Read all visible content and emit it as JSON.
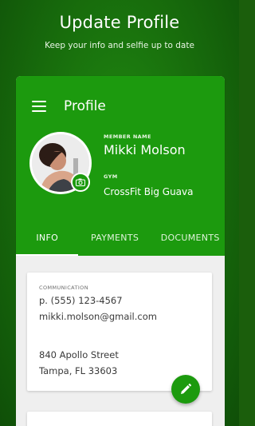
{
  "hero": {
    "title": "Update Profile",
    "subtitle": "Keep your info and selfie up to date"
  },
  "appbar": {
    "menu_icon": "hamburger-menu-icon",
    "title": "Profile"
  },
  "profile": {
    "avatar_icon": "user-photo",
    "camera_icon": "camera-icon",
    "member_label": "MEMBER NAME",
    "member_name": "Mikki Molson",
    "gym_label": "GYM",
    "gym_name": "CrossFit Big Guava"
  },
  "tabs": [
    {
      "label": "INFO",
      "active": true
    },
    {
      "label": "PAYMENTS",
      "active": false
    },
    {
      "label": "DOCUMENTS",
      "active": false
    }
  ],
  "communication": {
    "label": "COMMUNICATION",
    "phone": "p. (555) 123-4567",
    "email": "mikki.molson@gmail.com",
    "street": "840 Apollo Street",
    "city": "Tampa, FL 33603"
  },
  "fab": {
    "icon": "pencil-edit-icon"
  },
  "colors": {
    "brand_green": "#1c9a0e",
    "background_green": "#176a0c",
    "card_background": "#ffffff",
    "content_background": "#efefef"
  }
}
